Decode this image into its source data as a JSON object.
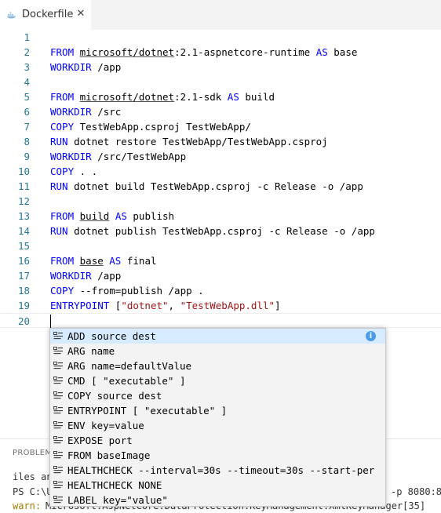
{
  "tab": {
    "title": "Dockerfile",
    "close": "✕"
  },
  "editor": {
    "lines": [
      {
        "n": "1",
        "tokens": []
      },
      {
        "n": "2",
        "tokens": [
          [
            "kw",
            "FROM"
          ],
          [
            "t",
            " "
          ],
          [
            "ul",
            "microsoft/dotnet"
          ],
          [
            "t",
            ":2.1-aspnetcore-runtime "
          ],
          [
            "kw",
            "AS"
          ],
          [
            "t",
            " base"
          ]
        ]
      },
      {
        "n": "3",
        "tokens": [
          [
            "kw",
            "WORKDIR"
          ],
          [
            "t",
            " /app"
          ]
        ]
      },
      {
        "n": "4",
        "tokens": []
      },
      {
        "n": "5",
        "tokens": [
          [
            "kw",
            "FROM"
          ],
          [
            "t",
            " "
          ],
          [
            "ul",
            "microsoft/dotnet"
          ],
          [
            "t",
            ":2.1-sdk "
          ],
          [
            "kw",
            "AS"
          ],
          [
            "t",
            " build"
          ]
        ]
      },
      {
        "n": "6",
        "tokens": [
          [
            "kw",
            "WORKDIR"
          ],
          [
            "t",
            " /src"
          ]
        ]
      },
      {
        "n": "7",
        "tokens": [
          [
            "kw",
            "COPY"
          ],
          [
            "t",
            " TestWebApp.csproj TestWebApp/"
          ]
        ]
      },
      {
        "n": "8",
        "tokens": [
          [
            "kw",
            "RUN"
          ],
          [
            "t",
            " dotnet restore TestWebApp/TestWebApp.csproj"
          ]
        ]
      },
      {
        "n": "9",
        "tokens": [
          [
            "kw",
            "WORKDIR"
          ],
          [
            "t",
            " /src/TestWebApp"
          ]
        ]
      },
      {
        "n": "10",
        "tokens": [
          [
            "kw",
            "COPY"
          ],
          [
            "t",
            " . ."
          ]
        ]
      },
      {
        "n": "11",
        "tokens": [
          [
            "kw",
            "RUN"
          ],
          [
            "t",
            " dotnet build TestWebApp.csproj -c Release -o /app"
          ]
        ]
      },
      {
        "n": "12",
        "tokens": []
      },
      {
        "n": "13",
        "tokens": [
          [
            "kw",
            "FROM"
          ],
          [
            "t",
            " "
          ],
          [
            "ul",
            "build"
          ],
          [
            "t",
            " "
          ],
          [
            "kw",
            "AS"
          ],
          [
            "t",
            " publish"
          ]
        ]
      },
      {
        "n": "14",
        "tokens": [
          [
            "kw",
            "RUN"
          ],
          [
            "t",
            " dotnet publish TestWebApp.csproj -c Release -o /app"
          ]
        ]
      },
      {
        "n": "15",
        "tokens": []
      },
      {
        "n": "16",
        "tokens": [
          [
            "kw",
            "FROM"
          ],
          [
            "t",
            " "
          ],
          [
            "ul",
            "base"
          ],
          [
            "t",
            " "
          ],
          [
            "kw",
            "AS"
          ],
          [
            "t",
            " final"
          ]
        ]
      },
      {
        "n": "17",
        "tokens": [
          [
            "kw",
            "WORKDIR"
          ],
          [
            "t",
            " /app"
          ]
        ]
      },
      {
        "n": "18",
        "tokens": [
          [
            "kw",
            "COPY"
          ],
          [
            "t",
            " --from=publish /app ."
          ]
        ]
      },
      {
        "n": "19",
        "tokens": [
          [
            "kw",
            "ENTRYPOINT"
          ],
          [
            "t",
            " ["
          ],
          [
            "str",
            "\"dotnet\""
          ],
          [
            "t",
            ", "
          ],
          [
            "str",
            "\"TestWebApp.dll\""
          ],
          [
            "t",
            "]"
          ]
        ]
      },
      {
        "n": "20",
        "tokens": []
      }
    ]
  },
  "panel": {
    "tab_label": "PROBLEM",
    "term_lines": [
      {
        "text": "iles an",
        "warn": false
      },
      {
        "text": "PS C:\\U",
        "warn": false
      },
      {
        "text": "-p 8080:8",
        "warn": false
      },
      {
        "text": "warn: ",
        "warn": true
      },
      {
        "text": "Microsoft.AspNetCore.DataProtection.KeyManagement.XmlKeyManager[35]",
        "warn": false
      }
    ]
  },
  "suggest": {
    "items": [
      "ADD source dest",
      "ARG name",
      "ARG name=defaultValue",
      "CMD [ \"executable\" ]",
      "COPY source dest",
      "ENTRYPOINT [ \"executable\" ]",
      "ENV key=value",
      "EXPOSE port",
      "FROM baseImage",
      "HEALTHCHECK --interval=30s --timeout=30s --start-per",
      "HEALTHCHECK NONE",
      "LABEL key=\"value\""
    ],
    "selected_index": 0,
    "info_label": "i",
    "item_icon": "snippet-icon"
  },
  "colors": {
    "keyword": "#0000ff",
    "string": "#a31515",
    "line_number": "#237893",
    "selection": "#d6ebff"
  }
}
